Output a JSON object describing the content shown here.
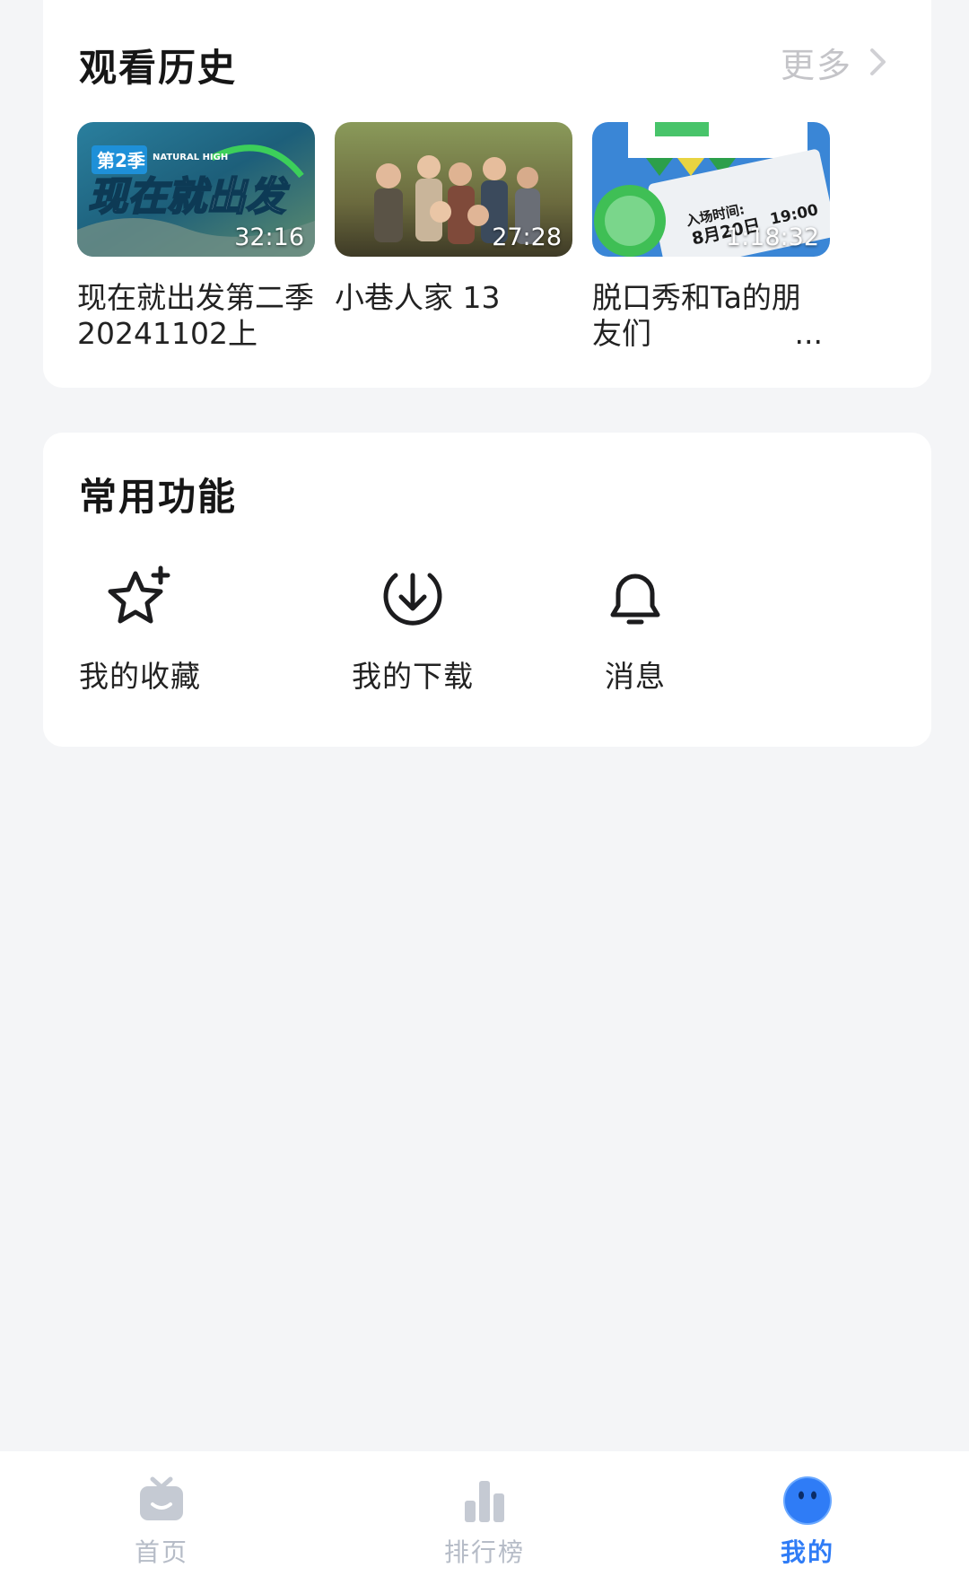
{
  "history": {
    "title": "观看历史",
    "more_label": "更多",
    "items": [
      {
        "title": "现在就出发第二季 20241102上",
        "duration": "32:16",
        "ellipsis": ""
      },
      {
        "title": "小巷人家 13",
        "duration": "27:28",
        "ellipsis": ""
      },
      {
        "title": "脱口秀和Ta的朋友们",
        "duration": "1:18:32",
        "ellipsis": "..."
      }
    ],
    "thumb_text": {
      "item1_badge": "第2季",
      "item1_brand": "NATURAL HIGH",
      "item1_show": "现在就出发",
      "item3_line1": "入场时间:",
      "item3_line2": "8月20日",
      "item3_line3": "19:00"
    }
  },
  "functions": {
    "title": "常用功能",
    "items": [
      {
        "label": "我的收藏",
        "icon": "star-plus-icon"
      },
      {
        "label": "我的下载",
        "icon": "download-icon"
      },
      {
        "label": "消息",
        "icon": "bell-icon"
      }
    ]
  },
  "tabbar": {
    "tabs": [
      {
        "label": "首页",
        "icon": "home-tv-icon",
        "active": false
      },
      {
        "label": "排行榜",
        "icon": "ranking-bars-icon",
        "active": false
      },
      {
        "label": "我的",
        "icon": "profile-face-icon",
        "active": true
      }
    ]
  },
  "colors": {
    "accent": "#2f7cf6",
    "inactive_tab": "#b6bcc7",
    "background": "#f4f5f7"
  }
}
